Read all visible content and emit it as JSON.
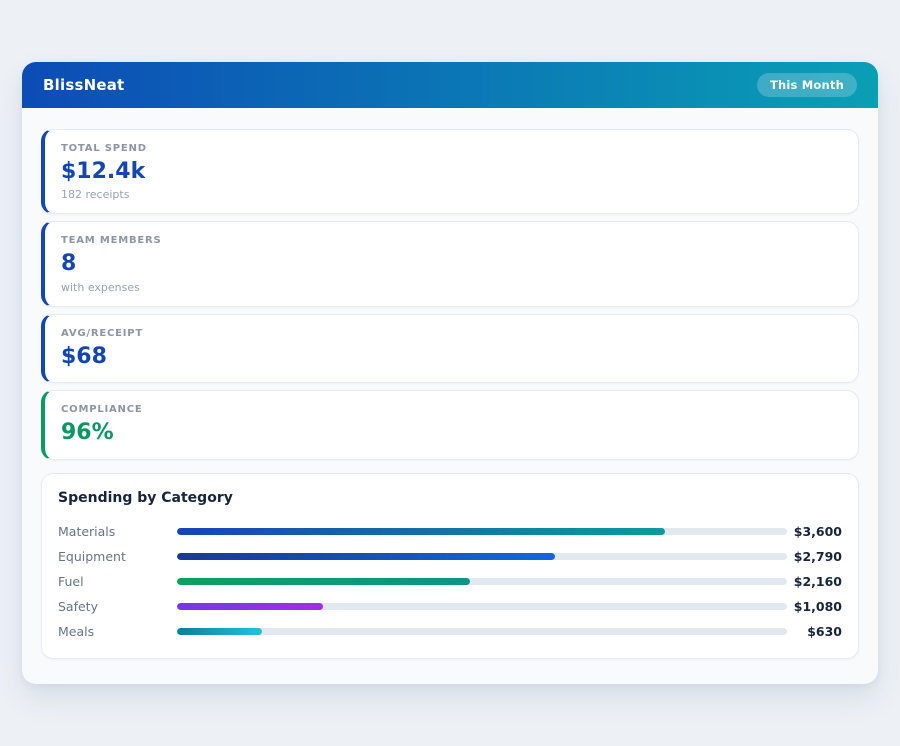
{
  "header": {
    "title": "BlissNeat",
    "badge": "This Month",
    "gradient_from": "#0c4cb5",
    "gradient_to": "#0a9fb5"
  },
  "stats": [
    {
      "label": "TOTAL SPEND",
      "value": "$12.4k",
      "sub": "182 receipts",
      "accent": "#1347b8",
      "value_color": "#1146b4"
    },
    {
      "label": "TEAM MEMBERS",
      "value": "8",
      "sub": "with expenses",
      "accent": "#1347b8",
      "value_color": "#1146b4"
    },
    {
      "label": "AVG/RECEIPT",
      "value": "$68",
      "sub": "",
      "accent": "#1347b8",
      "value_color": "#1146b4"
    },
    {
      "label": "COMPLIANCE",
      "value": "96%",
      "sub": "",
      "accent": "#0a9b5f",
      "value_color": "#089862"
    }
  ],
  "category_section": {
    "title": "Spending by Category",
    "track_color": "#e2e8f0",
    "rows": [
      {
        "label": "Materials",
        "value": "$3,600",
        "pct": 80,
        "color_from": "#1544b8",
        "color_to": "#0d9b9b"
      },
      {
        "label": "Equipment",
        "value": "$2,790",
        "pct": 62,
        "color_from": "#1a3a8f",
        "color_to": "#1565e0"
      },
      {
        "label": "Fuel",
        "value": "$2,160",
        "pct": 48,
        "color_from": "#0aa05c",
        "color_to": "#0d9488"
      },
      {
        "label": "Safety",
        "value": "$1,080",
        "pct": 24,
        "color_from": "#7338e8",
        "color_to": "#a62be8"
      },
      {
        "label": "Meals",
        "value": "$630",
        "pct": 14,
        "color_from": "#0d7f96",
        "color_to": "#22c3dd"
      }
    ]
  },
  "chart_data": {
    "type": "bar",
    "orientation": "horizontal",
    "title": "Spending by Category",
    "categories": [
      "Materials",
      "Equipment",
      "Fuel",
      "Safety",
      "Meals"
    ],
    "values": [
      3600,
      2790,
      2160,
      1080,
      630
    ],
    "value_labels": [
      "$3,600",
      "$2,790",
      "$2,160",
      "$1,080",
      "$630"
    ],
    "xlim": [
      0,
      4500
    ],
    "grid": false,
    "legend": false
  }
}
